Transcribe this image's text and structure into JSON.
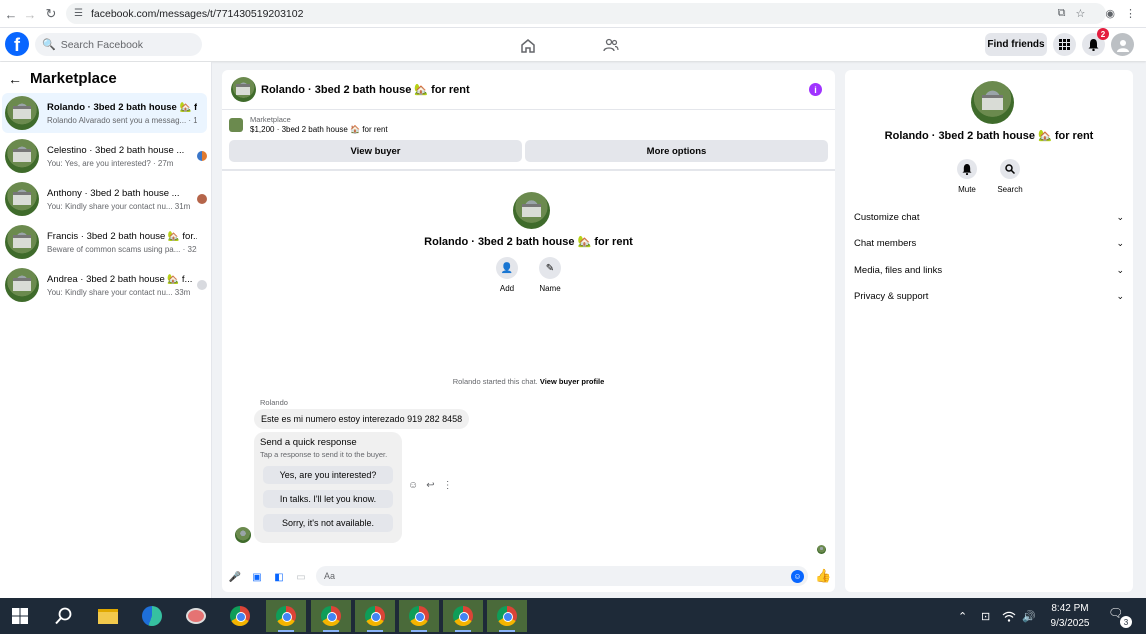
{
  "browser": {
    "url": "facebook.com/messages/t/771430519203102"
  },
  "fbnav": {
    "search_placeholder": "Search Facebook",
    "find_friends": "Find friends",
    "notification_count": "2",
    "logo_letter": "f"
  },
  "left": {
    "title": "Marketplace",
    "conversations": [
      {
        "name": "Rolando · 3bed 2 bath house 🏡 fo...",
        "snippet": "Rolando Alvarado sent you a messag... · 1m"
      },
      {
        "name": "Celestino · 3bed 2 bath house ...",
        "snippet": "You: Yes, are you interested? · 27m"
      },
      {
        "name": "Anthony · 3bed 2 bath house ...",
        "snippet": "You: Kindly share your contact nu... 31m"
      },
      {
        "name": "Francis · 3bed 2 bath house 🏡 for...",
        "snippet": "Beware of common scams using pa... · 32m"
      },
      {
        "name": "Andrea · 3bed 2 bath house 🏡 f...",
        "snippet": "You: Kindly share your contact nu... 33m"
      }
    ]
  },
  "chat": {
    "title": "Rolando · 3bed 2 bath house 🏡 for rent",
    "listing_label": "Marketplace",
    "listing_price": "$1,200 · 3bed 2 bath house 🏠 for rent",
    "view_buyer": "View buyer",
    "more_options": "More options",
    "add_label": "Add",
    "name_label": "Name",
    "started_text": "Rolando started this chat.",
    "view_profile": "View buyer profile",
    "sender": "Rolando",
    "message": "Este es mi numero estoy interezado 919 282 8458",
    "quick_title": "Send a quick response",
    "quick_sub": "Tap a response to send it to the buyer.",
    "quick_responses": [
      "Yes, are you interested?",
      "In talks. I'll let you know.",
      "Sorry, it's not available."
    ],
    "compose_placeholder": "Aa"
  },
  "right": {
    "name": "Rolando · 3bed 2 bath house 🏡 for rent",
    "mute": "Mute",
    "search": "Search",
    "sections": [
      "Customize chat",
      "Chat members",
      "Media, files and links",
      "Privacy & support"
    ]
  },
  "taskbar": {
    "time": "8:42 PM",
    "date": "9/3/2025",
    "notif_count": "3"
  },
  "colors": {
    "fb_blue": "#0866ff",
    "active_row": "#ebf5ff",
    "info_purple": "#a033ff",
    "badge_red": "#e41e3f"
  }
}
